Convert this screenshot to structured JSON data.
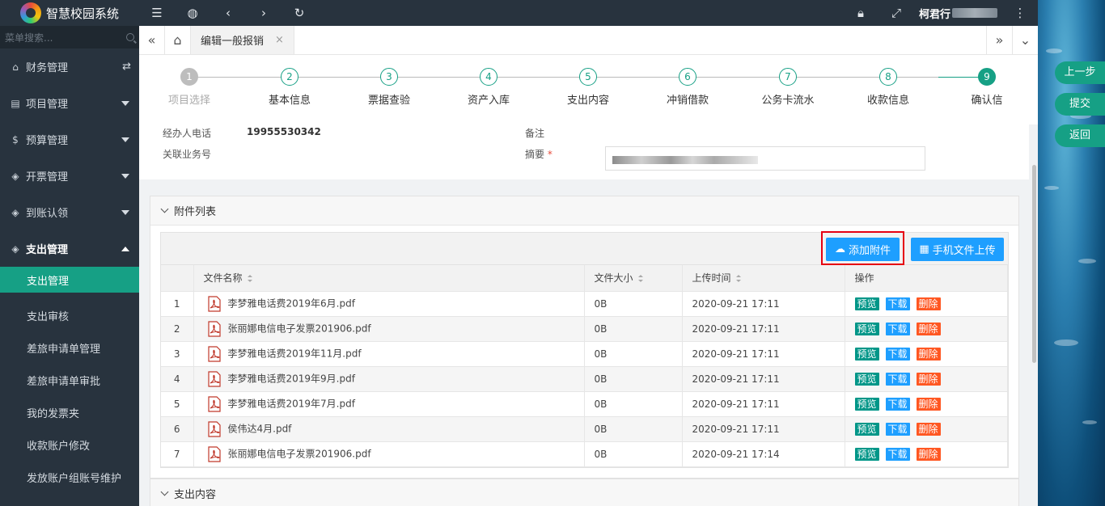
{
  "app": {
    "title": "智慧校园系统"
  },
  "sidebar": {
    "search_placeholder": "菜单搜索...",
    "groups": [
      {
        "label": "财务管理",
        "icon": "home-icon"
      },
      {
        "label": "项目管理",
        "icon": "book-icon"
      },
      {
        "label": "预算管理",
        "icon": "dollar-icon"
      },
      {
        "label": "开票管理",
        "icon": "cube-icon"
      },
      {
        "label": "到账认领",
        "icon": "cube-icon"
      },
      {
        "label": "支出管理",
        "icon": "cube-icon"
      }
    ],
    "sub_items": [
      "支出管理",
      "支出审核",
      "差旅申请单管理",
      "差旅申请单审批",
      "我的发票夹",
      "收款账户修改",
      "发放账户组账号维护"
    ]
  },
  "topbar": {
    "user": "柯君行"
  },
  "tabs": {
    "active": "编辑一般报销"
  },
  "steps": [
    {
      "num": "1",
      "label": "项目选择"
    },
    {
      "num": "2",
      "label": "基本信息"
    },
    {
      "num": "3",
      "label": "票据查验"
    },
    {
      "num": "4",
      "label": "资产入库"
    },
    {
      "num": "5",
      "label": "支出内容"
    },
    {
      "num": "6",
      "label": "冲销借款"
    },
    {
      "num": "7",
      "label": "公务卡流水"
    },
    {
      "num": "8",
      "label": "收款信息"
    },
    {
      "num": "9",
      "label": "确认信"
    }
  ],
  "actions": {
    "prev": "上一步",
    "submit": "提交",
    "back": "返回"
  },
  "info": {
    "phone_label": "经办人电话",
    "phone_value": "19955530342",
    "remark_label": "备注",
    "related_label": "关联业务号",
    "summary_label": "摘要",
    "required_mark": "*"
  },
  "attachments": {
    "title": "附件列表",
    "add_button": "添加附件",
    "mobile_button": "手机文件上传",
    "columns": {
      "name": "文件名称",
      "size": "文件大小",
      "time": "上传时间",
      "ops": "操作"
    },
    "op_labels": {
      "preview": "预览",
      "download": "下载",
      "delete": "删除"
    },
    "rows": [
      {
        "idx": "1",
        "name": "李梦雅电话费2019年6月.pdf",
        "size": "0B",
        "time": "2020-09-21 17:11"
      },
      {
        "idx": "2",
        "name": "张丽娜电信电子发票201906.pdf",
        "size": "0B",
        "time": "2020-09-21 17:11"
      },
      {
        "idx": "3",
        "name": "李梦雅电话费2019年11月.pdf",
        "size": "0B",
        "time": "2020-09-21 17:11"
      },
      {
        "idx": "4",
        "name": "李梦雅电话费2019年9月.pdf",
        "size": "0B",
        "time": "2020-09-21 17:11"
      },
      {
        "idx": "5",
        "name": "李梦雅电话费2019年7月.pdf",
        "size": "0B",
        "time": "2020-09-21 17:11"
      },
      {
        "idx": "6",
        "name": "侯伟达4月.pdf",
        "size": "0B",
        "time": "2020-09-21 17:11"
      },
      {
        "idx": "7",
        "name": "张丽娜电信电子发票201906.pdf",
        "size": "0B",
        "time": "2020-09-21 17:14"
      }
    ]
  },
  "expense_section": {
    "title": "支出内容"
  },
  "colors": {
    "accent": "#16a085",
    "primary": "#1e9fff",
    "danger": "#ff5722",
    "sidebar": "#28333e"
  }
}
